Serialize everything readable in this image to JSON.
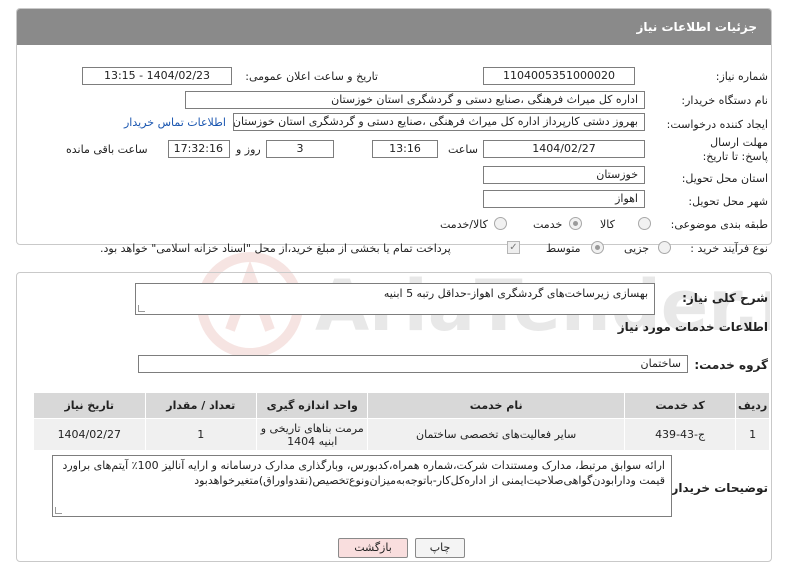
{
  "header": {
    "title": "جزئیات اطلاعات نیاز"
  },
  "fields": {
    "need_number_label": "شماره نیاز:",
    "need_number": "1104005351000020",
    "announce_label": "تاریخ و ساعت اعلان عمومی:",
    "announce_value": "1404/02/23 - 13:15",
    "buyer_org_label": "نام دستگاه خریدار:",
    "buyer_org": "اداره کل میراث فرهنگی ،صنایع دستی و گردشگری استان خوزستان",
    "creator_label": "ایجاد کننده درخواست:",
    "creator": "بهروز دشتی کارپرداز اداره کل میراث فرهنگی ،صنایع دستی و گردشگری استان خوزستان",
    "contact_link": "اطلاعات تماس خریدار",
    "deadline_label": "مهلت ارسال پاسخ: تا تاریخ:",
    "deadline_date": "1404/02/27",
    "time_label": "ساعت",
    "deadline_time": "13:16",
    "days_value": "3",
    "days_label": "روز و",
    "remaining_time": "17:32:16",
    "remaining_label": "ساعت باقی مانده",
    "province_label": "استان محل تحویل:",
    "province": "خوزستان",
    "city_label": "شهر محل تحویل:",
    "city": "اهواز",
    "category_label": "طبقه بندی موضوعی:",
    "category_options": [
      "کالا",
      "خدمت",
      "کالا/خدمت"
    ],
    "category_selected": "خدمت",
    "purchase_label": "نوع فرآیند خرید :",
    "purchase_options": [
      "جزیی",
      "متوسط"
    ],
    "purchase_selected": "متوسط",
    "payment_note": "پرداخت تمام یا بخشی از مبلغ خرید،از محل \"اسناد خزانه اسلامی\" خواهد بود."
  },
  "summary": {
    "label": "شرح کلی نیاز:",
    "text": "بهسازی زیرساخت‌های گردشگری اهواز-حداقل رتبه 5 ابنیه"
  },
  "services_section": {
    "title": "اطلاعات خدمات مورد نیاز",
    "group_label": "گروه خدمت:",
    "group_value": "ساختمان",
    "columns": [
      "ردیف",
      "کد خدمت",
      "نام خدمت",
      "واحد اندازه گیری",
      "تعداد / مقدار",
      "تاریخ نیاز"
    ],
    "rows": [
      [
        "1",
        "ج-43-439",
        "سایر فعالیت‌های تخصصی ساختمان",
        "مرمت بناهای تاریخی و ابنیه 1404",
        "1",
        "1404/02/27"
      ]
    ]
  },
  "buyer_notes": {
    "label": "توضیحات خریدار:",
    "text": "ارائه سوابق مرتبط، مدارک ومستندات شرکت،شماره همراه،کدبورس، وبارگذاری مدارک درسامانه و ارایه آنالیز 100٪ آیتم‌های براورد قیمت ودارابودن‌گواهی‌صلاحیت‌ایمنی از اداره‌کل‌کار-باتوجه‌به‌میزان‌ونوع‌تخصیص(نقدواوراق)متغیرخواهدبود"
  },
  "buttons": {
    "print": "چاپ",
    "back": "بازگشت"
  },
  "watermark": {
    "text": "AriaTender.neT"
  },
  "colors": {
    "header_bg": "#8a8a8a",
    "link": "#1a56b0",
    "back_bg": "#f9dede",
    "watermark": "#c0392b"
  }
}
